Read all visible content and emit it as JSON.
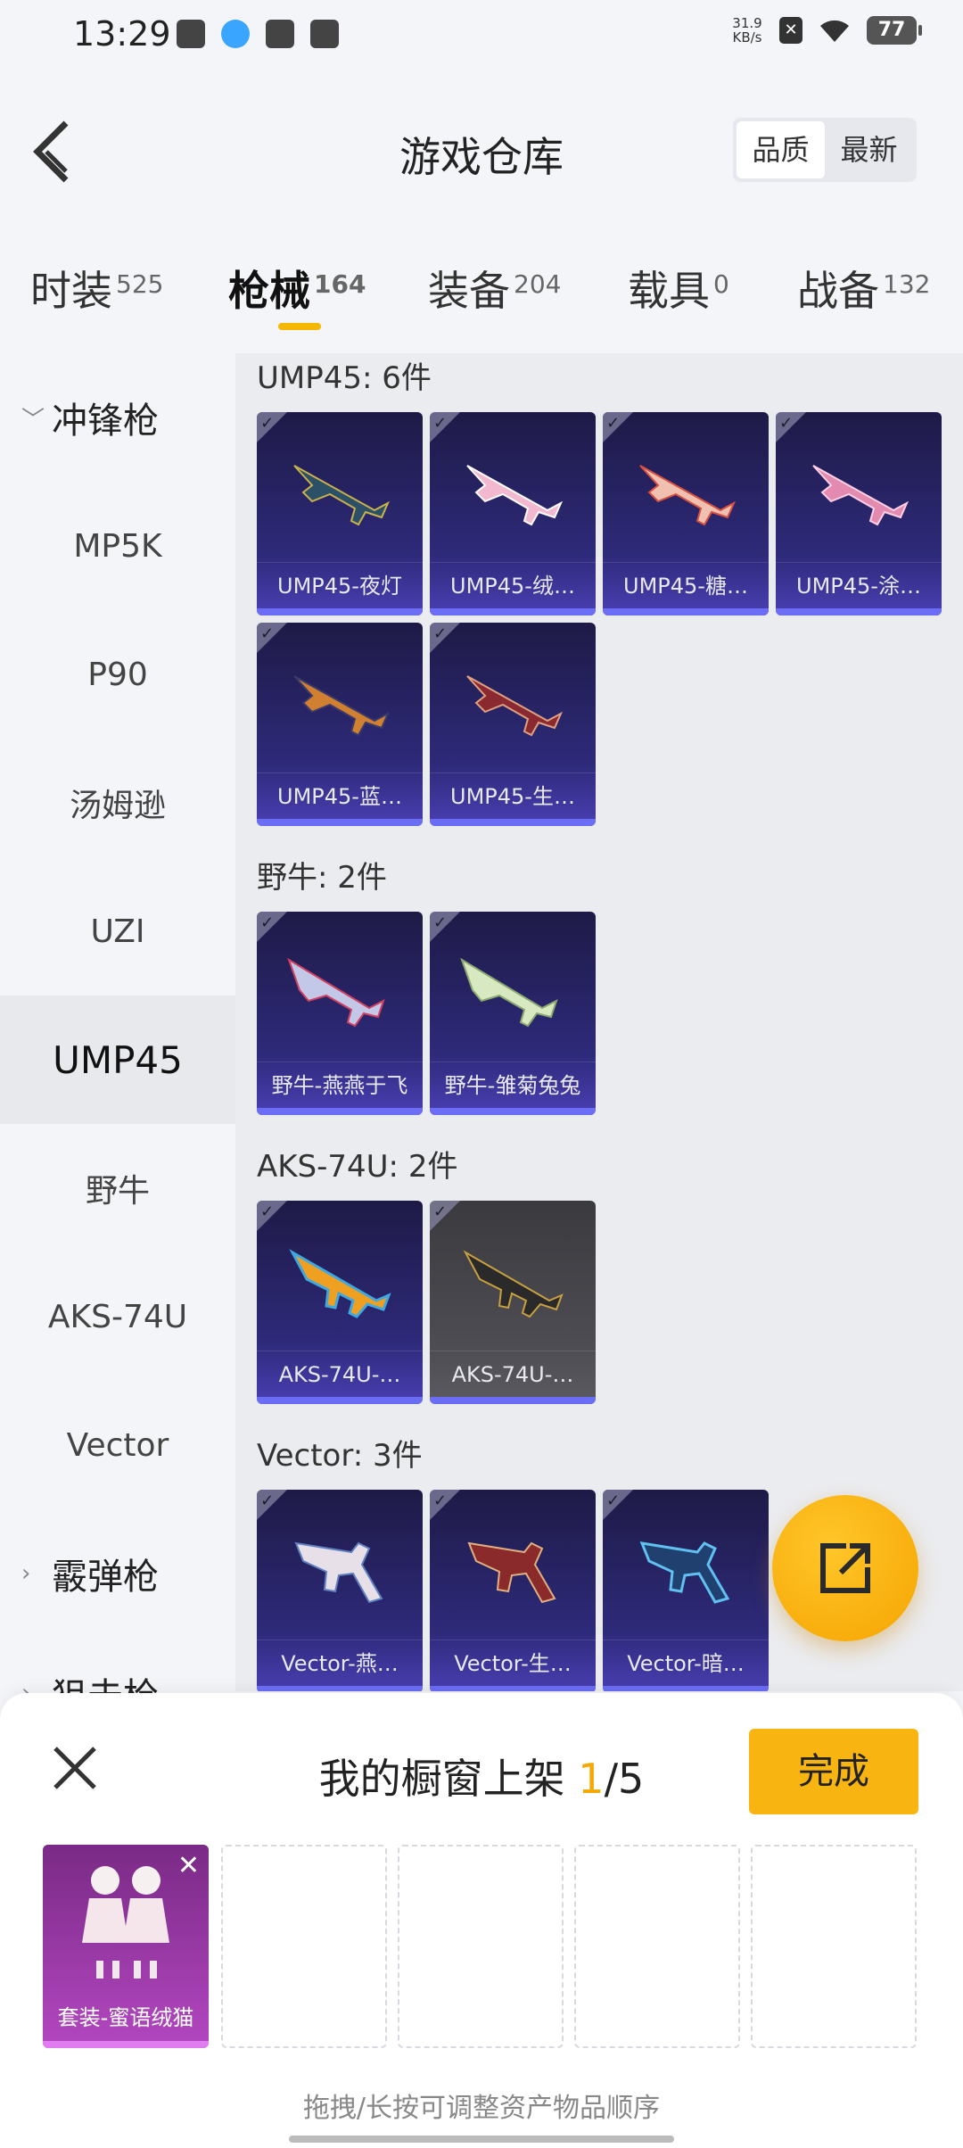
{
  "status_bar": {
    "time": "13:29",
    "net_speed_value": "31.9",
    "net_speed_unit": "KB/s",
    "battery": "77"
  },
  "header": {
    "title": "游戏仓库",
    "sort_options": [
      "品质",
      "最新"
    ]
  },
  "category_tabs": [
    {
      "label": "时装",
      "count": "525"
    },
    {
      "label": "枪械",
      "count": "164"
    },
    {
      "label": "装备",
      "count": "204"
    },
    {
      "label": "载具",
      "count": "0"
    },
    {
      "label": "战备",
      "count": "132"
    }
  ],
  "sidebar": {
    "group_open": "冲锋枪",
    "items": [
      "MP5K",
      "P90",
      "汤姆逊",
      "UZI",
      "UMP45",
      "野牛",
      "AKS-74U",
      "Vector"
    ],
    "group_closed": "霰弹枪",
    "next_group_partial": "狙击枪"
  },
  "sections": [
    {
      "title": "UMP45: 6件",
      "items": [
        "UMP45-夜灯",
        "UMP45-绒…",
        "UMP45-糖…",
        "UMP45-涂…",
        "UMP45-蓝…",
        "UMP45-生…"
      ]
    },
    {
      "title": "野牛: 2件",
      "items": [
        "野牛-燕燕于飞",
        "野牛-雏菊兔兔"
      ]
    },
    {
      "title": "AKS-74U: 2件",
      "items": [
        "AKS-74U-…",
        "AKS-74U-…"
      ]
    },
    {
      "title": "Vector: 3件",
      "items": [
        "Vector-燕…",
        "Vector-生…",
        "Vector-暗…"
      ]
    }
  ],
  "sheet": {
    "title_prefix": "我的橱窗上架 ",
    "count_current": "1",
    "count_total": "/5",
    "done_label": "完成",
    "slot_filled_label": "套装-蜜语绒猫",
    "hint": "拖拽/长按可调整资产物品顺序"
  },
  "colors": {
    "accent": "#f5b800",
    "card_purple": "#2e2a7a",
    "card_bar": "#6b6ef5"
  },
  "icons": [
    "back-icon",
    "share-icon",
    "close-icon",
    "checkmark-icon",
    "chevron-down-icon",
    "chevron-right-icon"
  ]
}
